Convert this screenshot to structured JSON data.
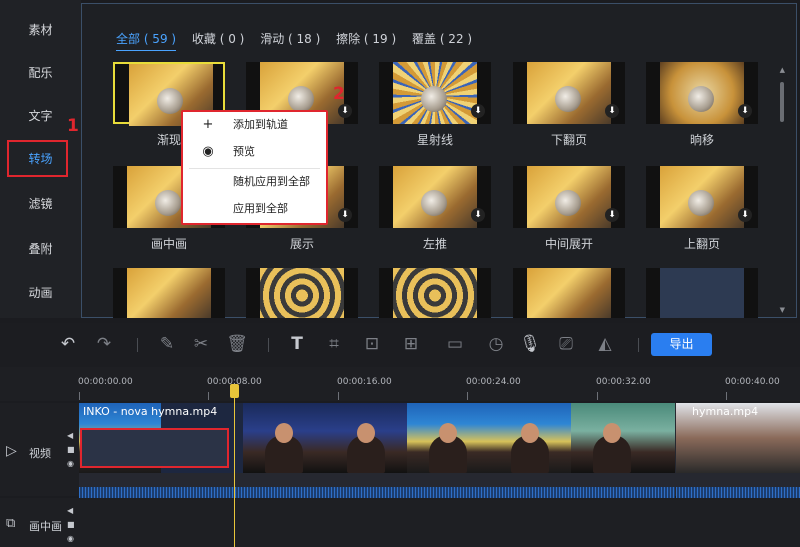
{
  "sidebar": {
    "items": [
      "素材",
      "配乐",
      "文字",
      "转场",
      "滤镜",
      "叠附",
      "动画"
    ],
    "active_index": 3
  },
  "annotations": {
    "one": "1",
    "two": "2"
  },
  "tabs": [
    {
      "label": "全部 ( 59 )",
      "active": true
    },
    {
      "label": "收藏 ( 0 )"
    },
    {
      "label": "滑动 ( 18 )"
    },
    {
      "label": "擦除 ( 19 )"
    },
    {
      "label": "覆盖 ( 22 )"
    }
  ],
  "transitions": [
    {
      "label": "渐现",
      "selected": true
    },
    {
      "label": ""
    },
    {
      "label": "星射线",
      "style": "rays"
    },
    {
      "label": "下翻页"
    },
    {
      "label": "晌移"
    },
    {
      "label": "画中画"
    },
    {
      "label": "展示"
    },
    {
      "label": "左推"
    },
    {
      "label": "中间展开"
    },
    {
      "label": "上翻页"
    },
    {
      "label": ""
    },
    {
      "label": "",
      "style": "spiral"
    },
    {
      "label": "",
      "style": "spiral"
    },
    {
      "label": ""
    },
    {
      "label": "",
      "style": "blank"
    }
  ],
  "context_menu": {
    "items": [
      {
        "icon": "plus-icon",
        "glyph": "+",
        "label": "添加到轨道"
      },
      {
        "icon": "eye-icon",
        "glyph": "◉",
        "label": "预览"
      },
      {
        "icon": "",
        "glyph": "",
        "label": "随机应用到全部"
      },
      {
        "icon": "",
        "glyph": "",
        "label": "应用到全部"
      }
    ]
  },
  "toolbar": {
    "export_label": "导出"
  },
  "ruler": {
    "ticks": [
      "00:00:00.00",
      "00:00:08.00",
      "00:00:16.00",
      "00:00:24.00",
      "00:00:32.00",
      "00:00:40.00"
    ]
  },
  "tracks": {
    "video": {
      "label": "视频",
      "clip1": "INKO - nova hymna.mp4",
      "clip2": "hymna.mp4"
    },
    "pip": {
      "label": "画中画"
    }
  },
  "colors": {
    "accent": "#4aa3ff",
    "highlight": "#e0262e",
    "export": "#2a7ef0",
    "playhead": "#e8c53a"
  }
}
